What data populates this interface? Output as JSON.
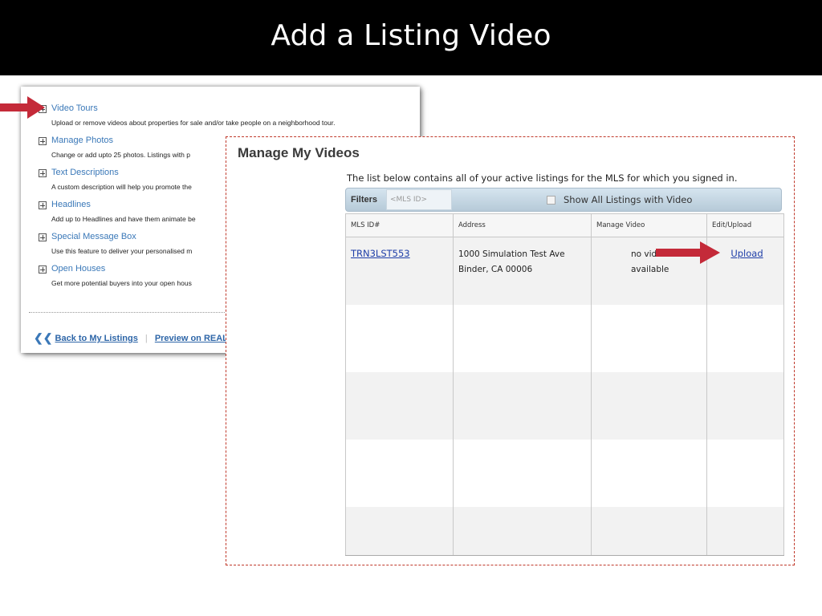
{
  "slide": {
    "title": "Add a Listing Video"
  },
  "listing_panel": {
    "features": [
      {
        "title": "Video Tours",
        "desc": "Upload or remove videos about properties for sale and/or take people on a neighborhood tour."
      },
      {
        "title": "Manage Photos",
        "desc": "Change or add upto 25 photos. Listings with p"
      },
      {
        "title": "Text Descriptions",
        "desc": "A custom description will help you promote the"
      },
      {
        "title": "Headlines",
        "desc": "Add up to Headlines and have them animate be"
      },
      {
        "title": "Special Message Box",
        "desc": "Use this feature to deliver your personalised m"
      },
      {
        "title": "Open Houses",
        "desc": "Get more potential buyers into your open hous"
      }
    ],
    "back_link": "Back to My Listings",
    "preview_link": "Preview on REALT"
  },
  "videos_panel": {
    "title": "Manage My Videos",
    "intro": "The list below contains all of your active listings for the MLS for which you signed in.",
    "filters_label": "Filters",
    "mls_placeholder": "<MLS ID>",
    "show_all_label": "Show All Listings with Video",
    "columns": [
      "MLS ID#",
      "Address",
      "Manage Video",
      "Edit/Upload"
    ],
    "row": {
      "mls_id": "TRN3LST553",
      "address_line1": "1000 Simulation Test Ave",
      "address_line2": "Binder, CA 00006",
      "video_line1": "no video",
      "video_line2": "available",
      "action": "Upload"
    }
  },
  "colors": {
    "arrow": "#c42a39",
    "link": "#1e3ea8",
    "feature_title": "#3a78b8"
  },
  "icons": [
    "expand-plus-icon",
    "double-chevron-left-icon",
    "red-arrow-icon"
  ]
}
